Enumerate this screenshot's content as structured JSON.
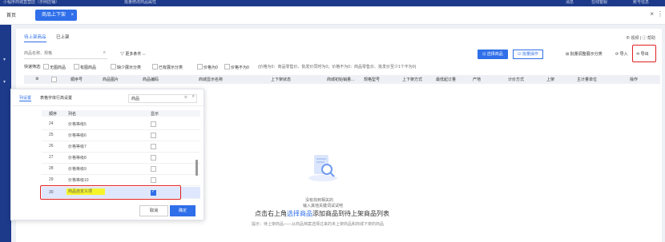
{
  "topbar": {
    "left": "小程序商城直营店（示例店铺）",
    "middle": "批量修改商品属性",
    "right_msg": "消息",
    "right_service": "在线客服",
    "right_user": "账号信息"
  },
  "tabs": {
    "home": "首页",
    "active": "商品上下架",
    "close_glyph": "×",
    "window_close": "×",
    "more": "⋮"
  },
  "subtabs": [
    "待上架商品",
    "已上架"
  ],
  "top_right": "⊕ 视频 | ⓘ 帮助",
  "search": {
    "placeholder": "商品名称、规格"
  },
  "more_conditions": "▽ 更多条件 ⌵",
  "buttons": {
    "select_goods": "⊡ 选择商品",
    "batch_ops": "☑ 批量操作",
    "batch_display": "⊞ 批量调整展示分类",
    "import": "⟳ 导入",
    "export": "⟲ 导出"
  },
  "quick_filter": {
    "label": "快速筛选:",
    "items": [
      "无图商品",
      "有图商品",
      "缺少展示分类",
      "已有展示分类",
      "价格为0",
      "价格不为0"
    ],
    "hint": "(价格为0：商品零售价、批发价同时为0；价格不为0：商品零售价、批发价至少1个不为0)"
  },
  "table_headers": [
    "顺序号",
    "商品图片",
    "商品编码",
    "商城显示名称",
    "上下架状态",
    "商城初始销量...",
    "规格型号",
    "上下架方式",
    "最低起订量",
    "产地",
    "计价方式",
    "上架",
    "主计量单位",
    "操作"
  ],
  "empty": {
    "line1": "没有找到相关的",
    "line2": "输入其他关键词试试吧",
    "main_pre": "点击右上角",
    "main_link": "选择商品",
    "main_post": "添加商品到待上架商品列表",
    "hint": "提示：待上架商品——从商品档案选择过来的未上架商品和商城下架的商品"
  },
  "popup": {
    "tab_active": "列设置",
    "tab_other": "表格字体行高设置",
    "search_value": "商品",
    "clear_glyph": "⊗",
    "col_seq": "顺序",
    "col_name": "列名",
    "col_show": "显示",
    "rows": [
      {
        "seq": "24",
        "name": "价格等级5",
        "checked": false
      },
      {
        "seq": "25",
        "name": "价格等级6",
        "checked": false
      },
      {
        "seq": "26",
        "name": "价格等级7",
        "checked": false
      },
      {
        "seq": "27",
        "name": "价格等级8",
        "checked": false
      },
      {
        "seq": "28",
        "name": "价格等级9",
        "checked": false
      },
      {
        "seq": "29",
        "name": "价格等级10",
        "checked": false
      },
      {
        "seq": "30",
        "name": "商品自定义项",
        "checked": true
      }
    ],
    "cancel": "取消",
    "ok": "确定"
  },
  "colors": {
    "primary": "#2f6fe9",
    "highlight_red": "#e02020",
    "highlight_yellow": "#f7f52a",
    "nav": "#1d3a8a"
  }
}
